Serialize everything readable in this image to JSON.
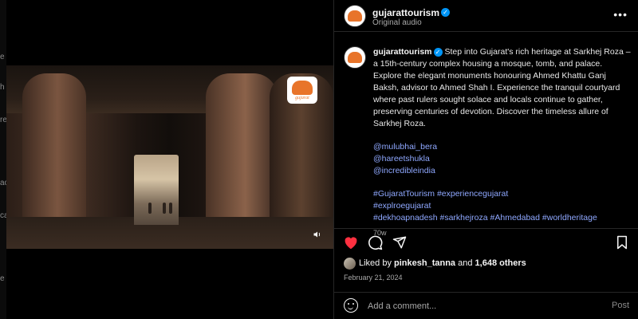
{
  "left_strip": {
    "chars": [
      "e",
      "h",
      "re",
      "ac",
      "ca",
      "e"
    ]
  },
  "video": {
    "logo_text": "gujarat",
    "sound_icon": "speaker-icon"
  },
  "post": {
    "author": "gujarattourism",
    "audio": "Original audio",
    "caption": "Step into Gujarat's rich heritage at Sarkhej Roza – a 15th-century complex housing a mosque, tomb, and palace. Explore the elegant monuments honouring Ahmed Khattu Ganj Baksh, advisor to Ahmed Shah I. Experience the tranquil courtyard where past rulers sought solace and locals continue to gather, preserving centuries of devotion. Discover the timeless allure of Sarkhej Roza.",
    "mentions": [
      "@mulubhai_bera",
      "@hareetshukla",
      "@incredibleindia"
    ],
    "hashtags": "#GujaratTourism #experiencegujarat #explroegujarat #dekhoapnadesh #sarkhejroza #Ahmedabad #worldheritage",
    "hashtags_line1": "#GujaratTourism #experiencegujarat",
    "hashtags_line2": "#explroegujarat",
    "hashtags_line3": "#dekhoapnadesh #sarkhejroza #Ahmedabad #worldheritage",
    "time_ago": "70w",
    "liked_by_prefix": "Liked by ",
    "liked_by_user": "pinkesh_tanna",
    "liked_by_and": " and ",
    "likes_count": "1,648 others",
    "date": "February 21, 2024",
    "liked": true
  },
  "comment": {
    "placeholder": "Add a comment...",
    "post_label": "Post"
  },
  "colors": {
    "like_red": "#ff3040",
    "link_blue": "#8fa8ff",
    "verified_blue": "#0095f6",
    "brand_orange": "#e8742a"
  }
}
